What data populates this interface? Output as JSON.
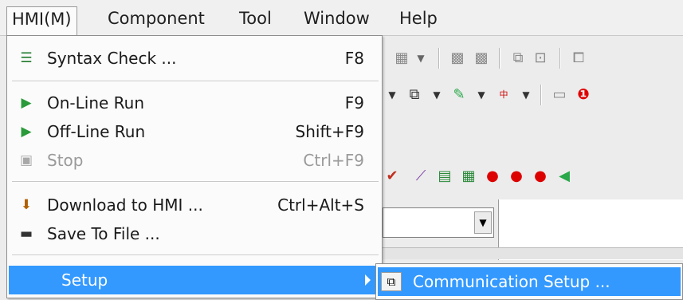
{
  "menubar": {
    "items": [
      {
        "label": "HMI(M)"
      },
      {
        "label": "Component"
      },
      {
        "label": "Tool"
      },
      {
        "label": "Window"
      },
      {
        "label": "Help"
      }
    ]
  },
  "hmi_menu": {
    "items": [
      {
        "label": "Syntax Check ...",
        "shortcut": "F8",
        "icon": "syntax-check-icon",
        "enabled": true
      },
      {
        "label": "On-Line Run",
        "shortcut": "F9",
        "icon": "online-run-icon",
        "enabled": true
      },
      {
        "label": "Off-Line Run",
        "shortcut": "Shift+F9",
        "icon": "offline-run-icon",
        "enabled": true
      },
      {
        "label": "Stop",
        "shortcut": "Ctrl+F9",
        "icon": "stop-icon",
        "enabled": false
      },
      {
        "label": "Download to HMI ...",
        "shortcut": "Ctrl+Alt+S",
        "icon": "download-icon",
        "enabled": true
      },
      {
        "label": "Save To File ...",
        "shortcut": "",
        "icon": "save-file-icon",
        "enabled": true
      },
      {
        "label": "Setup",
        "shortcut": "",
        "icon": "",
        "enabled": true,
        "highlighted": true,
        "has_submenu": true
      }
    ]
  },
  "setup_submenu": {
    "items": [
      {
        "label": "Communication Setup ...",
        "icon": "communication-setup-icon",
        "highlighted": true
      }
    ]
  },
  "colors": {
    "highlight": "#3399ff",
    "menu_bg": "#fbfbfb",
    "disabled_text": "#9a9a9a"
  }
}
